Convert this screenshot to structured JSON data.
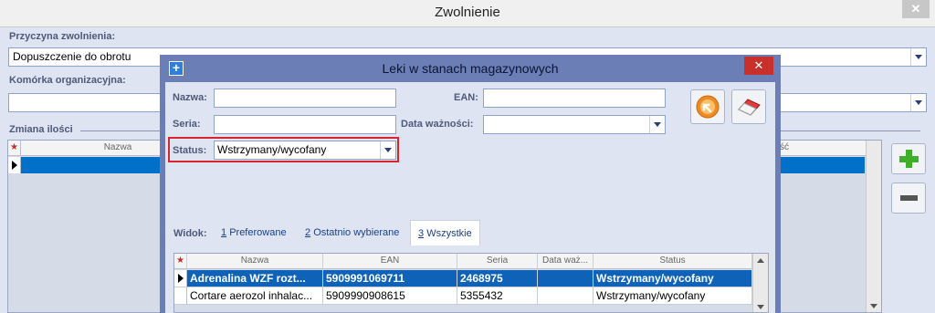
{
  "outer_window": {
    "title": "Zwolnienie",
    "close_label": "✕",
    "reason_label": "Przyczyna zwolnienia:",
    "reason_value": "Dopuszczenie do obrotu",
    "org_unit_label": "Komórka organizacyjna:",
    "org_unit_value": "",
    "qty_section_label": "Zmiana ilości",
    "grid": {
      "columns": [
        "Nazwa",
        "ść"
      ]
    }
  },
  "modal": {
    "title": "Leki w stanach magazynowych",
    "close_label": "✕",
    "fields": {
      "name_label": "Nazwa:",
      "name_value": "",
      "ean_label": "EAN:",
      "ean_value": "",
      "series_label": "Seria:",
      "series_value": "",
      "expiry_label": "Data ważności:",
      "expiry_value": "",
      "status_label": "Status:",
      "status_value": "Wstrzymany/wycofany"
    },
    "view": {
      "label": "Widok:",
      "tabs": [
        {
          "key": "1",
          "label": "Preferowane"
        },
        {
          "key": "2",
          "label": "Ostatnio wybierane"
        },
        {
          "key": "3",
          "label": "Wszystkie"
        }
      ],
      "active_index": 2
    },
    "grid": {
      "columns": [
        "Nazwa",
        "EAN",
        "Seria",
        "Data waż...",
        "Status"
      ],
      "rows": [
        {
          "name": "Adrenalina WZF rozt...",
          "ean": "5909991069711",
          "series": "2468975",
          "expiry": "",
          "status": "Wstrzymany/wycofany",
          "selected": true
        },
        {
          "name": "Cortare aerozol inhalac...",
          "ean": "5909990908615",
          "series": "5355432",
          "expiry": "",
          "status": "Wstrzymany/wycofany",
          "selected": false
        }
      ]
    }
  },
  "icons": {
    "select": "select-arrow-icon",
    "clear": "eraser-icon",
    "add": "plus-icon",
    "remove": "minus-icon"
  },
  "colors": {
    "selection": "#0e63b8",
    "dialog_frame": "#6b7fb6",
    "highlight_border": "#d8242d",
    "add_green": "#3fae2a"
  }
}
